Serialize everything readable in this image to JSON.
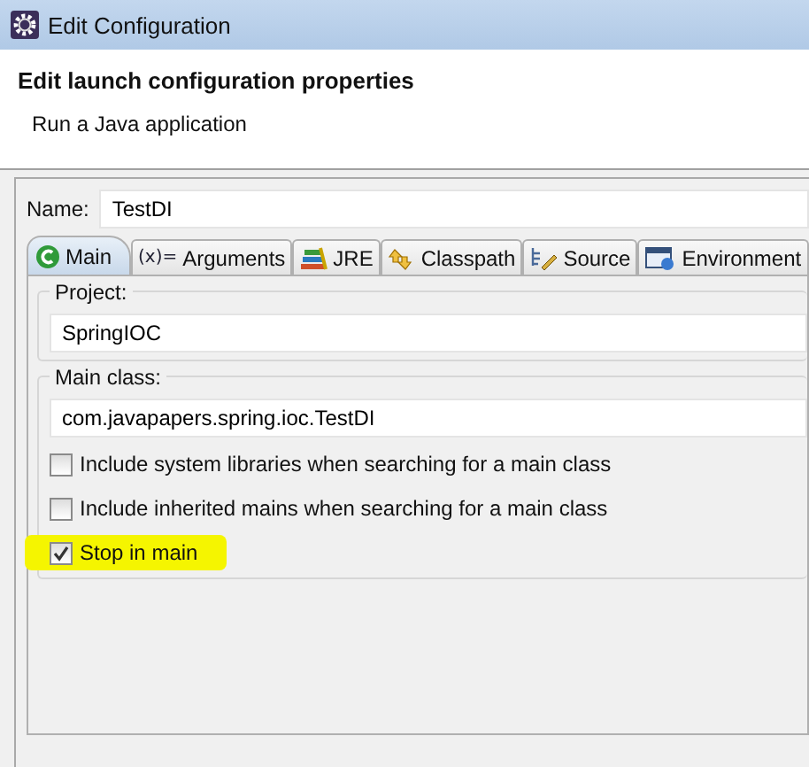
{
  "window": {
    "title": "Edit Configuration"
  },
  "header": {
    "title": "Edit launch configuration properties",
    "subtitle": "Run a Java application"
  },
  "name_field": {
    "label": "Name:",
    "value": "TestDI"
  },
  "tabs": [
    {
      "label": "Main",
      "selected": true
    },
    {
      "label": "Arguments",
      "symbol": "(x)=",
      "selected": false
    },
    {
      "label": "JRE",
      "selected": false
    },
    {
      "label": "Classpath",
      "selected": false
    },
    {
      "label": "Source",
      "selected": false
    },
    {
      "label": "Environment",
      "selected": false
    }
  ],
  "project": {
    "label": "Project:",
    "value": "SpringIOC"
  },
  "main_class": {
    "label": "Main class:",
    "value": "com.javapapers.spring.ioc.TestDI"
  },
  "options": [
    {
      "label": "Include system libraries when searching for a main class",
      "checked": false,
      "highlighted": false
    },
    {
      "label": "Include inherited mains when searching for a main class",
      "checked": false,
      "highlighted": false
    },
    {
      "label": "Stop in main",
      "checked": true,
      "highlighted": true
    }
  ]
}
